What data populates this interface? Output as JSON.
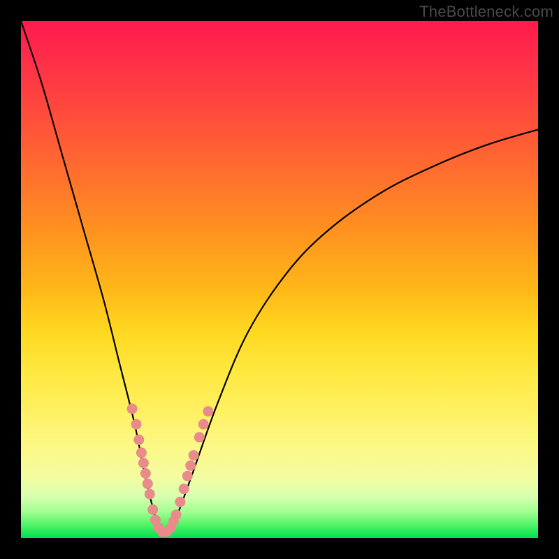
{
  "watermark": "TheBottleneck.com",
  "chart_data": {
    "type": "line",
    "title": "",
    "xlabel": "",
    "ylabel": "",
    "xlim": [
      0,
      100
    ],
    "ylim": [
      0,
      100
    ],
    "grid": false,
    "series": [
      {
        "name": "bottleneck-curve",
        "x": [
          0,
          4,
          8,
          12,
          16,
          19,
          22,
          24,
          26,
          27,
          28,
          30,
          33,
          38,
          44,
          52,
          60,
          70,
          80,
          90,
          100
        ],
        "values": [
          100,
          88,
          74,
          60,
          46,
          34,
          22,
          12,
          4,
          1,
          1,
          4,
          12,
          26,
          40,
          52,
          60,
          67,
          72,
          76,
          79
        ]
      }
    ],
    "markers": {
      "name": "highlight-dots",
      "color": "#e98b8b",
      "points": [
        {
          "x": 21.5,
          "y": 25
        },
        {
          "x": 22.3,
          "y": 22
        },
        {
          "x": 22.8,
          "y": 19
        },
        {
          "x": 23.3,
          "y": 16.5
        },
        {
          "x": 23.7,
          "y": 14.5
        },
        {
          "x": 24.1,
          "y": 12.5
        },
        {
          "x": 24.5,
          "y": 10.5
        },
        {
          "x": 24.9,
          "y": 8.5
        },
        {
          "x": 25.5,
          "y": 5.5
        },
        {
          "x": 26.0,
          "y": 3.5
        },
        {
          "x": 26.6,
          "y": 2.0
        },
        {
          "x": 27.3,
          "y": 1.2
        },
        {
          "x": 28.2,
          "y": 1.2
        },
        {
          "x": 29.0,
          "y": 2.0
        },
        {
          "x": 29.5,
          "y": 3.2
        },
        {
          "x": 30.0,
          "y": 4.5
        },
        {
          "x": 30.8,
          "y": 7.0
        },
        {
          "x": 31.5,
          "y": 9.5
        },
        {
          "x": 32.2,
          "y": 12.0
        },
        {
          "x": 32.8,
          "y": 14.0
        },
        {
          "x": 33.4,
          "y": 16.0
        },
        {
          "x": 34.5,
          "y": 19.5
        },
        {
          "x": 35.3,
          "y": 22.0
        },
        {
          "x": 36.2,
          "y": 24.5
        }
      ]
    }
  }
}
